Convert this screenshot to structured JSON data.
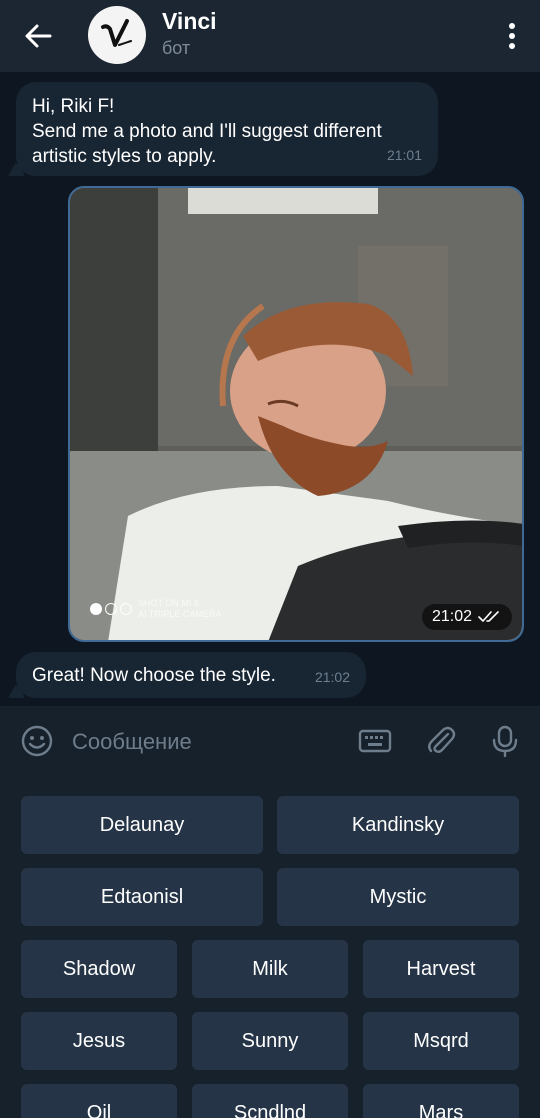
{
  "header": {
    "title": "Vinci",
    "subtitle": "бот",
    "back_icon": "arrow-left-icon",
    "menu_icon": "more-vertical-icon"
  },
  "messages": [
    {
      "lines": [
        "Hi, Riki F!",
        "Send me a photo and I'll suggest different",
        "artistic styles to apply."
      ],
      "time": "21:01"
    },
    {
      "type": "photo",
      "time": "21:02",
      "status_icon": "double-check-icon",
      "watermark": [
        "SHOT ON MI 8",
        "AI TRIPLE CAMERA"
      ]
    },
    {
      "text": "Great! Now choose the style.",
      "time": "21:02"
    }
  ],
  "input": {
    "placeholder": "Сообщение",
    "emoji_icon": "emoji-icon",
    "keyboard_icon": "keyboard-icon",
    "attach_icon": "paperclip-icon",
    "mic_icon": "microphone-icon"
  },
  "keyboard": {
    "rows": [
      [
        "Delaunay",
        "Kandinsky"
      ],
      [
        "Edtaonisl",
        "Mystic"
      ],
      [
        "Shadow",
        "Milk",
        "Harvest"
      ],
      [
        "Jesus",
        "Sunny",
        "Msqrd"
      ],
      [
        "Oil",
        "Scndlnd",
        "Mars"
      ]
    ]
  },
  "colors": {
    "background": "#0e1621",
    "header": "#1c2633",
    "incoming_bubble": "#182533",
    "button": "#253446",
    "accent_border": "#3f6a96"
  }
}
